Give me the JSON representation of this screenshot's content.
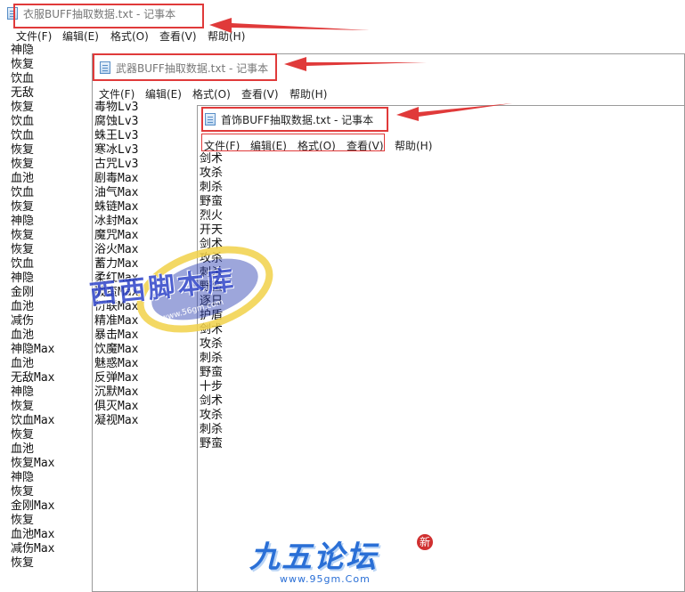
{
  "windows": [
    {
      "id": "w1",
      "title": "衣服BUFF抽取数据.txt - 记事本",
      "menu": [
        "文件(F)",
        "编辑(E)",
        "格式(O)",
        "查看(V)",
        "帮助(H)"
      ],
      "lines": [
        "神隐",
        "恢复",
        "饮血",
        "无敌",
        "恢复",
        "饮血",
        "饮血",
        "恢复",
        "恢复",
        "血池",
        "饮血",
        "恢复",
        "神隐",
        "恢复",
        "恢复",
        "饮血",
        "神隐",
        "金刚",
        "血池",
        "减伤",
        "血池",
        "神隐Max",
        "血池",
        "无敌Max",
        "神隐",
        "恢复",
        "饮血Max",
        "恢复",
        "血池",
        "恢复Max",
        "神隐",
        "恢复",
        "金刚Max",
        "恢复",
        "血池Max",
        "减伤Max",
        "恢复"
      ]
    },
    {
      "id": "w2",
      "title": "武器BUFF抽取数据.txt - 记事本",
      "menu": [
        "文件(F)",
        "编辑(E)",
        "格式(O)",
        "查看(V)",
        "帮助(H)"
      ],
      "lines": [
        "毒物Lv3",
        "腐蚀Lv3",
        "蛛王Lv3",
        "寒冰Lv3",
        "古咒Lv3",
        "剧毒Max",
        "油气Max",
        "蛛链Max",
        "冰封Max",
        "魔咒Max",
        "浴火Max",
        "蓄力Max",
        "柔红Max",
        "破蛮Max",
        "衍联Max",
        "精准Max",
        "暴击Max",
        "饮魔Max",
        "魅惑Max",
        "反弹Max",
        "沉默Max",
        "俱灭Max",
        "凝视Max"
      ]
    },
    {
      "id": "w3",
      "title": "首饰BUFF抽取数据.txt - 记事本",
      "menu": [
        "文件(F)",
        "编辑(E)",
        "格式(O)",
        "查看(V)",
        "帮助(H)"
      ],
      "lines": [
        "剑术",
        "攻杀",
        "刺杀",
        "野蛮",
        "烈火",
        "开天",
        "剑术",
        "攻杀",
        "刺杀",
        "野蛮",
        "逐日",
        "护盾",
        "剑术",
        "攻杀",
        "刺杀",
        "野蛮",
        "十步",
        "剑术",
        "攻杀",
        "刺杀",
        "野蛮"
      ]
    }
  ],
  "watermark": {
    "text": "西西脚本库",
    "url": "www.56gm.com"
  },
  "logo": {
    "text": "九五论坛",
    "url": "www.95gm.Com",
    "badge": "新"
  },
  "colors": {
    "highlight": "#e03a3a"
  }
}
